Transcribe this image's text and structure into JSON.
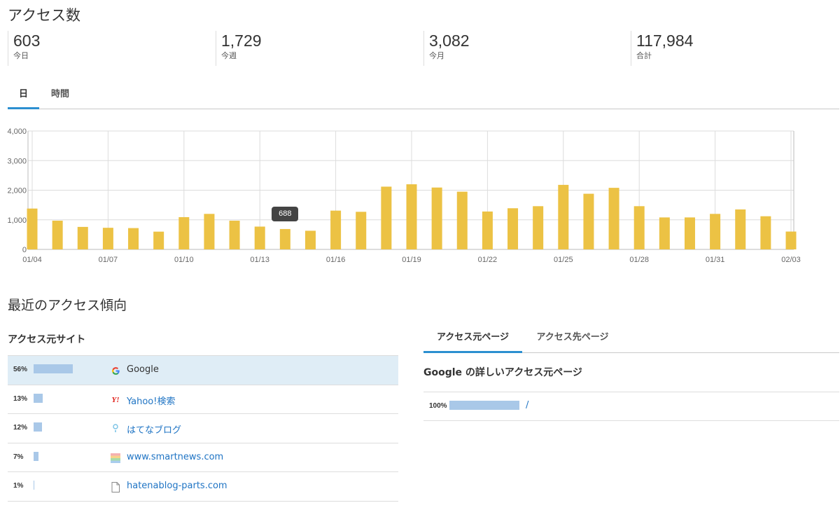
{
  "page_title": "アクセス数",
  "stats": [
    {
      "value": "603",
      "label": "今日"
    },
    {
      "value": "1,729",
      "label": "今週"
    },
    {
      "value": "3,082",
      "label": "今月"
    },
    {
      "value": "117,984",
      "label": "合計"
    }
  ],
  "period_tabs": [
    {
      "label": "日",
      "active": true
    },
    {
      "label": "時間",
      "active": false
    }
  ],
  "chart_data": {
    "type": "bar",
    "categories": [
      "01/04",
      "01/05",
      "01/06",
      "01/07",
      "01/08",
      "01/09",
      "01/10",
      "01/11",
      "01/12",
      "01/13",
      "01/14",
      "01/15",
      "01/16",
      "01/17",
      "01/18",
      "01/19",
      "01/20",
      "01/21",
      "01/22",
      "01/23",
      "01/24",
      "01/25",
      "01/26",
      "01/27",
      "01/28",
      "01/29",
      "01/30",
      "01/31",
      "02/01",
      "02/02",
      "02/03"
    ],
    "x_tick_labels": [
      "01/04",
      "01/07",
      "01/10",
      "01/13",
      "01/16",
      "01/19",
      "01/22",
      "01/25",
      "01/28",
      "01/31",
      "02/03"
    ],
    "values": [
      1380,
      970,
      760,
      730,
      720,
      600,
      1090,
      1200,
      970,
      770,
      688,
      630,
      1310,
      1270,
      2120,
      2200,
      2090,
      1950,
      1280,
      1390,
      1460,
      2180,
      1880,
      2080,
      1460,
      1080,
      1080,
      1200,
      1350,
      1120,
      603
    ],
    "y_tick_labels": [
      "4,000",
      "3,000",
      "2,000",
      "1,000",
      "0"
    ],
    "ylim": [
      0,
      4000
    ],
    "bar_color": "#ecc244",
    "grid": true,
    "tooltip": {
      "index": 10,
      "label": "688"
    }
  },
  "trend_title": "最近のアクセス傾向",
  "sources": {
    "title": "アクセス元サイト",
    "items": [
      {
        "pct": "56%",
        "share": 56,
        "icon": "google-icon",
        "site": "Google",
        "link": false
      },
      {
        "pct": "13%",
        "share": 13,
        "icon": "yahoo-icon",
        "site": "Yahoo!検索",
        "link": true
      },
      {
        "pct": "12%",
        "share": 12,
        "icon": "hatena-blog-icon",
        "site": "はてなブログ",
        "link": true
      },
      {
        "pct": "7%",
        "share": 7,
        "icon": "smartnews-icon",
        "site": "www.smartnews.com",
        "link": true
      },
      {
        "pct": "1%",
        "share": 1,
        "icon": "document-icon",
        "site": "hatenablog-parts.com",
        "link": true
      }
    ]
  },
  "page_tabs": [
    {
      "label": "アクセス元ページ",
      "active": true
    },
    {
      "label": "アクセス先ページ",
      "active": false
    }
  ],
  "detail": {
    "title": "Google の詳しいアクセス元ページ",
    "items": [
      {
        "pct": "100%",
        "share": 100,
        "path": "/"
      }
    ]
  },
  "colors": {
    "accent": "#2c8fd0",
    "bar": "#ecc244",
    "share_bar": "#a9c8e8",
    "highlight_row": "#dfedf6",
    "link": "#1f74c4"
  }
}
